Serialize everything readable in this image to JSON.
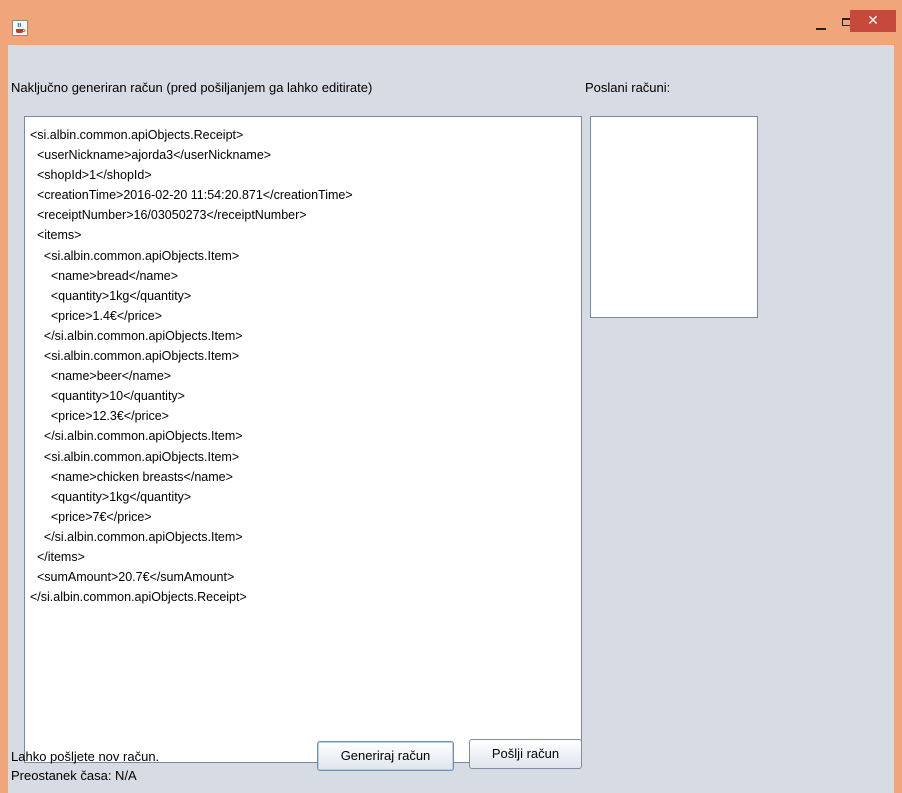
{
  "window": {
    "title": "",
    "close_glyph": "✕"
  },
  "main": {
    "receipt_label": "Naključno generiran račun (pred pošiljanjem ga lahko editirate)",
    "sent_label": "Poslani računi:",
    "receipt_xml": "<si.albin.common.apiObjects.Receipt>\n  <userNickname>ajorda3</userNickname>\n  <shopId>1</shopId>\n  <creationTime>2016-02-20 11:54:20.871</creationTime>\n  <receiptNumber>16/03050273</receiptNumber>\n  <items>\n    <si.albin.common.apiObjects.Item>\n      <name>bread</name>\n      <quantity>1kg</quantity>\n      <price>1.4€</price>\n    </si.albin.common.apiObjects.Item>\n    <si.albin.common.apiObjects.Item>\n      <name>beer</name>\n      <quantity>10</quantity>\n      <price>12.3€</price>\n    </si.albin.common.apiObjects.Item>\n    <si.albin.common.apiObjects.Item>\n      <name>chicken breasts</name>\n      <quantity>1kg</quantity>\n      <price>7€</price>\n    </si.albin.common.apiObjects.Item>\n  </items>\n  <sumAmount>20.7€</sumAmount>\n</si.albin.common.apiObjects.Receipt>",
    "sent_receipts": []
  },
  "footer": {
    "status_line": "Lahko pošljete nov račun.",
    "time_left": "Preostanek časa: N/A",
    "generate_button": "Generiraj račun",
    "send_button": "Pošlji račun"
  },
  "colors": {
    "titlebar": "#f0a57a",
    "client_bg": "#d7dbe3",
    "close_button": "#c7493c"
  },
  "icons": {
    "app": "java-cup-icon",
    "minimize": "minimize-icon",
    "maximize": "maximize-icon",
    "close": "close-icon"
  }
}
